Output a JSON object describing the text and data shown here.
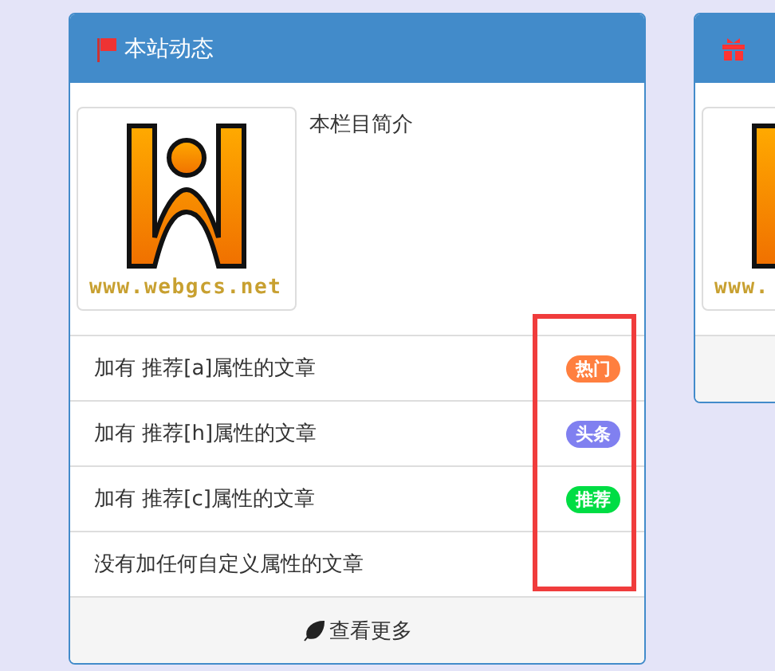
{
  "panels": [
    {
      "title": "本站动态",
      "logo_text": "www.webgcs.net",
      "intro": "本栏目简介",
      "articles": [
        {
          "title": "加有 推荐[a]属性的文章",
          "badge": "热门",
          "color": "#ff7f3f"
        },
        {
          "title": "加有 推荐[h]属性的文章",
          "badge": "头条",
          "color": "#8080f0"
        },
        {
          "title": "加有 推荐[c]属性的文章",
          "badge": "推荐",
          "color": "#00dd44"
        },
        {
          "title": "没有加任何自定义属性的文章"
        }
      ],
      "more": "查看更多"
    },
    {
      "logo_text": "www."
    }
  ]
}
